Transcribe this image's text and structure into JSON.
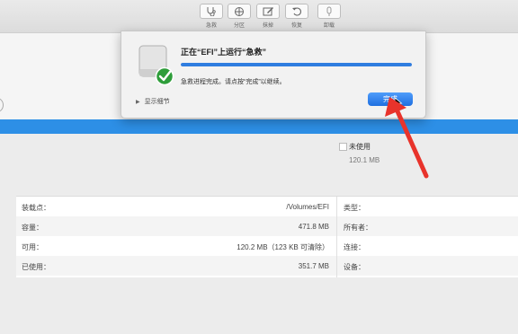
{
  "toolbar": {
    "buttons": [
      {
        "label": "急救",
        "icon": "stethoscope-icon"
      },
      {
        "label": "分区",
        "icon": "pie-partition-icon"
      },
      {
        "label": "抹掉",
        "icon": "erase-icon"
      },
      {
        "label": "恢复",
        "icon": "restore-icon"
      },
      {
        "label": "卸载",
        "icon": "eject-icon"
      }
    ]
  },
  "legend": {
    "label": "未使用",
    "size": "120.1 MB"
  },
  "info": {
    "rows": [
      {
        "label": "装载点：",
        "value": "/Volumes/EFI",
        "right_label": "类型："
      },
      {
        "label": "容量：",
        "value": "471.8 MB",
        "right_label": "所有者："
      },
      {
        "label": "可用：",
        "value": "120.2 MB（123 KB 可清除）",
        "right_label": "连接："
      },
      {
        "label": "已使用：",
        "value": "351.7 MB",
        "right_label": "设备："
      }
    ]
  },
  "dialog": {
    "title": "正在“EFI”上运行“急救”",
    "progress_fraction": 1.0,
    "message": "急救进程完成。请点按“完成”以继续。",
    "details_label": "显示细节",
    "done_label": "完成"
  },
  "annotation": {
    "arrow_color": "#e8332b"
  },
  "colors": {
    "usage_bar": "#2d8fe6",
    "accent": "#2f7de0"
  }
}
